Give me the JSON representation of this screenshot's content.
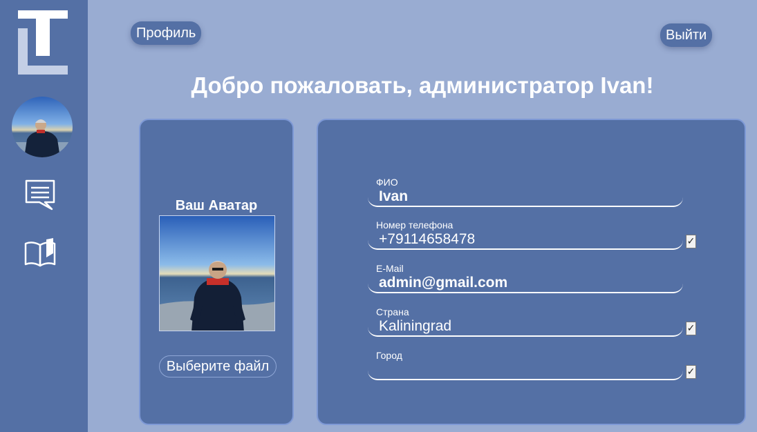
{
  "header": {
    "profile_label": "Профиль",
    "logout_label": "Выйти",
    "welcome": "Добро пожаловать, администратор Ivan!"
  },
  "sidebar": {
    "items": [
      {
        "icon": "avatar"
      },
      {
        "icon": "chat-icon"
      },
      {
        "icon": "book-icon"
      }
    ]
  },
  "avatar_panel": {
    "title": "Ваш Аватар",
    "file_button": "Выберите файл"
  },
  "profile": {
    "fields": [
      {
        "label": "ФИО",
        "value": "Ivan",
        "checkbox": false
      },
      {
        "label": "Номер телефона",
        "value": "+79114658478",
        "checkbox": true,
        "checked": true
      },
      {
        "label": "E-Mail",
        "value": "admin@gmail.com",
        "checkbox": false
      },
      {
        "label": "Страна",
        "value": "Kaliningrad",
        "checkbox": true,
        "checked": true
      },
      {
        "label": "Город",
        "value": "",
        "checkbox": true,
        "checked": true
      }
    ]
  },
  "colors": {
    "background": "#99acd2",
    "sidebar": "#5470a5",
    "panel": "#5470a5",
    "panel_border": "#7e99d6",
    "text": "#ffffff"
  }
}
